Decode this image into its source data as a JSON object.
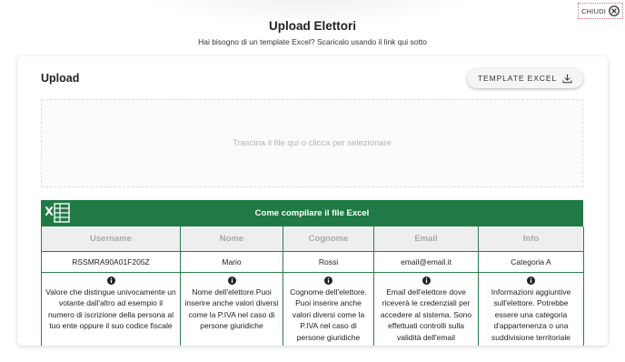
{
  "header": {
    "title": "Upload Elettori",
    "subtitle": "Hai bisogno di un template Excel? Scaricalo usando il link qui sotto",
    "close_label": "CHIUDI"
  },
  "card": {
    "heading": "Upload",
    "template_button_label": "TEMPLATE EXCEL",
    "dropzone_text": "Trascina il file qui o clicca per selezionare"
  },
  "excel_guide": {
    "title": "Come compilare il file Excel",
    "columns": [
      "Username",
      "Nome",
      "Cognome",
      "Email",
      "Info"
    ],
    "example_row": [
      "RSSMRA90A01F205Z",
      "Mario",
      "Rossi",
      "email@email.it",
      "Categoria A"
    ],
    "descriptions": [
      "Valore che distingue univocamente un votante dall'altro ad esempio il numero di iscrizione della persona al tuo ente oppure il suo codice fiscale",
      "Nome dell'elettore.Puoi inserire anche valori diversi come la P.IVA nel caso di persone giuridiche",
      "Cognome dell'elettore. Puoi inserire anche valori diversi come la P.IVA nel caso di persone giuridiche",
      "Email dell'elettore dove riceverà le credenziali per accedere al sistema. Sono effettuati controlli sulla validità dell'email",
      "Informazioni aggiuntive sull'elettore. Potrebbe essere una categoria d'appartenenza o una suddivisione territoriale"
    ]
  },
  "colors": {
    "excel_green": "#1f7a45",
    "close_border": "#d46a7a"
  },
  "icons": {
    "close": "close-circle-icon",
    "download": "download-icon",
    "excel": "excel-icon",
    "info": "info-icon"
  }
}
